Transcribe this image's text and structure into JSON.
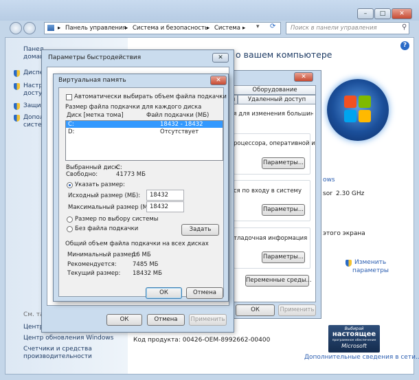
{
  "control_panel": {
    "address": {
      "crumb1": "Панель управления",
      "crumb2": "Система и безопасность",
      "crumb3": "Система",
      "sep": "▸"
    },
    "search_placeholder": "Поиск в панели управления",
    "sidebar": {
      "home": "Панел",
      "home2": "домаш",
      "item1": "Диспе",
      "item2a": "Настр",
      "item2b": "доступ",
      "item3": "Защит",
      "item4a": "Допол",
      "item4b": "систе",
      "see_also": "См. та",
      "link1": "Центр",
      "link2": "Центр обновления Windows",
      "link3a": "Счетчики и средства",
      "link3b": "производительности"
    },
    "heading": "о вашем компьютере",
    "right_texts": {
      "windows_tail": "ows",
      "cpu_label": "sor",
      "cpu_value": "2.30 GHz",
      "screen_tail": "этого экрана",
      "change_link_a": "Изменить",
      "change_link_b": "параметры"
    },
    "product_code": "Код продукта: 00426-OEM-8992662-00400",
    "more_info_link": "Дополнительные сведения в сети...",
    "genuine": {
      "line1": "Выбирай",
      "line2": "настоящее",
      "line3": "программное обеспечение",
      "line4": "Microsoft"
    },
    "help_icon": "?"
  },
  "system_properties": {
    "tab_hardware": "Оборудование",
    "tab_remote": "Удаленный доступ",
    "tab_fragment": "ля",
    "desc": "ля для изменения большинства",
    "perf_text_a": "роцессора, оперативной и",
    "params_btn1": "Параметры...",
    "login_text": "ся по входу в систему",
    "params_btn2": "Параметры...",
    "debug_text": "тладочная информация",
    "params_btn3": "Параметры...",
    "env_vars_btn": "Переменные среды...",
    "ok": "ОК",
    "cancel": "Отмена",
    "apply": "Применить"
  },
  "performance_options": {
    "title": "Параметры быстродействия",
    "ok": "ОК",
    "cancel": "Отмена",
    "apply": "Применить"
  },
  "virtual_memory": {
    "title": "Виртуальная память",
    "auto_checkbox": "Автоматически выбирать объем файла подкачки",
    "section_title": "Размер файла подкачки для каждого диска",
    "col_disk": "Диск [метка тома]",
    "col_size": "Файл подкачки (МБ)",
    "drives": [
      {
        "disk": "C:",
        "size": "18432 - 18432"
      },
      {
        "disk": "D:",
        "size": "Отсутствует"
      }
    ],
    "selected_disk_label": "Выбранный диск:",
    "selected_disk_value": "C:",
    "free_label": "Свободно:",
    "free_value": "41773 МБ",
    "custom_size": "Указать размер:",
    "initial_label": "Исходный размер (МБ):",
    "initial_value": "18432",
    "max_label": "Максимальный размер (МБ):",
    "max_value": "18432",
    "system_managed": "Размер по выбору системы",
    "no_paging": "Без файла подкачки",
    "set_btn": "Задать",
    "total_title": "Общий объем файла подкачки на всех дисках",
    "min_label": "Минимальный размер:",
    "min_value": "16 МБ",
    "rec_label": "Рекомендуется:",
    "rec_value": "7485 МБ",
    "cur_label": "Текущий размер:",
    "cur_value": "18432 МБ",
    "ok": "ОК",
    "cancel": "Отмена",
    "close_x": "✕"
  },
  "window_buttons": {
    "minimize": "–",
    "maximize": "□",
    "close": "✕"
  }
}
